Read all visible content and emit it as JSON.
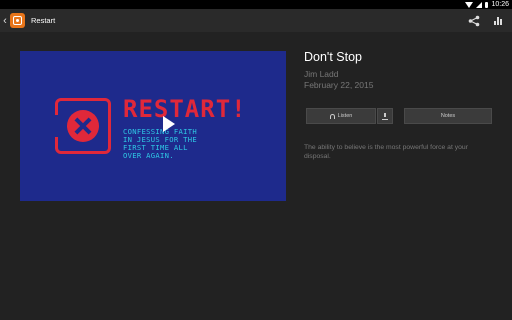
{
  "status_bar": {
    "time": "10:26"
  },
  "app_bar": {
    "back": "‹",
    "title": "Restart"
  },
  "video": {
    "logo_text": "RESTART!",
    "subtitle": "CONFESSING FAITH\nIN JESUS FOR THE\nFIRST TIME ALL\nOVER AGAIN."
  },
  "sermon": {
    "title": "Don't Stop",
    "author": "Jim Ladd",
    "date": "February 22, 2015",
    "listen_label": "Listen",
    "notes_label": "Notes",
    "description": "The ability to believe is the most powerful force at your disposal."
  }
}
